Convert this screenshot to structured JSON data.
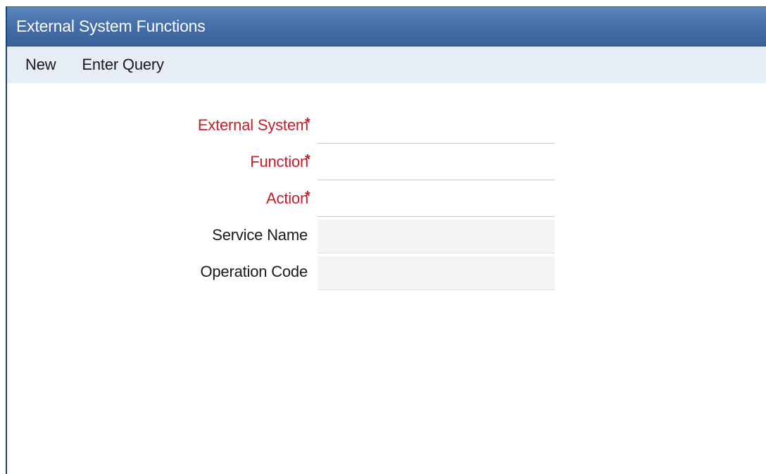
{
  "window": {
    "title": "External System Functions"
  },
  "toolbar": {
    "items": [
      {
        "label": "New"
      },
      {
        "label": "Enter Query"
      }
    ]
  },
  "form": {
    "fields": [
      {
        "label": "External System",
        "required": true,
        "value": ""
      },
      {
        "label": "Function",
        "required": true,
        "value": ""
      },
      {
        "label": "Action",
        "required": true,
        "value": ""
      },
      {
        "label": "Service Name",
        "required": false,
        "value": ""
      },
      {
        "label": "Operation Code",
        "required": false,
        "value": ""
      }
    ],
    "required_marker": "*"
  },
  "colors": {
    "title_bar": "#4670aa",
    "toolbar_bg": "#e6edf6",
    "required_label": "#c41e2a"
  }
}
